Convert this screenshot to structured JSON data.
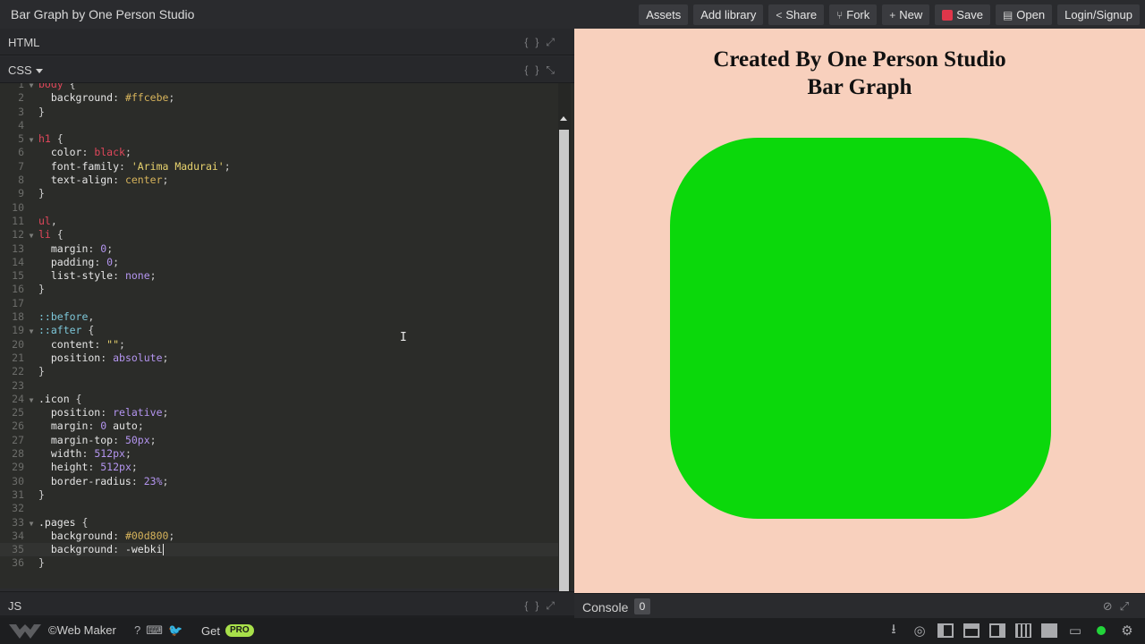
{
  "app": {
    "title": "Bar Graph by One Person Studio"
  },
  "toolbar": {
    "assets": "Assets",
    "add_library": "Add library",
    "share": "Share",
    "fork": "Fork",
    "new": "New",
    "save": "Save",
    "open": "Open",
    "login": "Login/Signup",
    "icons": {
      "share": "share-icon",
      "fork": "fork-icon",
      "new": "plus-icon",
      "save": "save-icon",
      "open": "document-icon"
    },
    "save_color": "#e0364a"
  },
  "panes": {
    "html_label": "HTML",
    "css_label": "CSS",
    "js_label": "JS",
    "tool_icons": [
      "braces-icon",
      "expand-icon"
    ]
  },
  "code": {
    "lines": [
      {
        "n": "1",
        "fold": true,
        "tokens": [
          {
            "t": "sel",
            "v": "body"
          },
          {
            "t": "pun",
            "v": " {"
          }
        ]
      },
      {
        "n": "2",
        "tokens": [
          {
            "t": "prop",
            "v": "  background"
          },
          {
            "t": "pun",
            "v": ": "
          },
          {
            "t": "val",
            "v": "#ffcebe"
          },
          {
            "t": "pun",
            "v": ";"
          }
        ]
      },
      {
        "n": "3",
        "tokens": [
          {
            "t": "pun",
            "v": "}"
          }
        ]
      },
      {
        "n": "4",
        "tokens": []
      },
      {
        "n": "5",
        "fold": true,
        "tokens": [
          {
            "t": "sel",
            "v": "h1"
          },
          {
            "t": "pun",
            "v": " {"
          }
        ]
      },
      {
        "n": "6",
        "tokens": [
          {
            "t": "prop",
            "v": "  color"
          },
          {
            "t": "pun",
            "v": ": "
          },
          {
            "t": "sel",
            "v": "black"
          },
          {
            "t": "pun",
            "v": ";"
          }
        ]
      },
      {
        "n": "7",
        "tokens": [
          {
            "t": "prop",
            "v": "  font-family"
          },
          {
            "t": "pun",
            "v": ": "
          },
          {
            "t": "str",
            "v": "'Arima Madurai'"
          },
          {
            "t": "pun",
            "v": ";"
          }
        ]
      },
      {
        "n": "8",
        "tokens": [
          {
            "t": "prop",
            "v": "  text-align"
          },
          {
            "t": "pun",
            "v": ": "
          },
          {
            "t": "val",
            "v": "center"
          },
          {
            "t": "pun",
            "v": ";"
          }
        ]
      },
      {
        "n": "9",
        "tokens": [
          {
            "t": "pun",
            "v": "}"
          }
        ]
      },
      {
        "n": "10",
        "tokens": []
      },
      {
        "n": "11",
        "tokens": [
          {
            "t": "sel",
            "v": "ul"
          },
          {
            "t": "pun",
            "v": ","
          }
        ]
      },
      {
        "n": "12",
        "fold": true,
        "tokens": [
          {
            "t": "sel",
            "v": "li"
          },
          {
            "t": "pun",
            "v": " {"
          }
        ]
      },
      {
        "n": "13",
        "tokens": [
          {
            "t": "prop",
            "v": "  margin"
          },
          {
            "t": "pun",
            "v": ": "
          },
          {
            "t": "num",
            "v": "0"
          },
          {
            "t": "pun",
            "v": ";"
          }
        ]
      },
      {
        "n": "14",
        "tokens": [
          {
            "t": "prop",
            "v": "  padding"
          },
          {
            "t": "pun",
            "v": ": "
          },
          {
            "t": "num",
            "v": "0"
          },
          {
            "t": "pun",
            "v": ";"
          }
        ]
      },
      {
        "n": "15",
        "tokens": [
          {
            "t": "prop",
            "v": "  list-style"
          },
          {
            "t": "pun",
            "v": ": "
          },
          {
            "t": "kw",
            "v": "none"
          },
          {
            "t": "pun",
            "v": ";"
          }
        ]
      },
      {
        "n": "16",
        "tokens": [
          {
            "t": "pun",
            "v": "}"
          }
        ]
      },
      {
        "n": "17",
        "tokens": []
      },
      {
        "n": "18",
        "tokens": [
          {
            "t": "pc",
            "v": "::before"
          },
          {
            "t": "pun",
            "v": ","
          }
        ]
      },
      {
        "n": "19",
        "fold": true,
        "tokens": [
          {
            "t": "pc",
            "v": "::after"
          },
          {
            "t": "pun",
            "v": " {"
          }
        ]
      },
      {
        "n": "20",
        "tokens": [
          {
            "t": "prop",
            "v": "  content"
          },
          {
            "t": "pun",
            "v": ": "
          },
          {
            "t": "str",
            "v": "\"\""
          },
          {
            "t": "pun",
            "v": ";"
          }
        ]
      },
      {
        "n": "21",
        "tokens": [
          {
            "t": "prop",
            "v": "  position"
          },
          {
            "t": "pun",
            "v": ": "
          },
          {
            "t": "kw",
            "v": "absolute"
          },
          {
            "t": "pun",
            "v": ";"
          }
        ]
      },
      {
        "n": "22",
        "tokens": [
          {
            "t": "pun",
            "v": "}"
          }
        ]
      },
      {
        "n": "23",
        "tokens": []
      },
      {
        "n": "24",
        "fold": true,
        "tokens": [
          {
            "t": "sel-b",
            "v": ".icon"
          },
          {
            "t": "pun",
            "v": " {"
          }
        ]
      },
      {
        "n": "25",
        "tokens": [
          {
            "t": "prop",
            "v": "  position"
          },
          {
            "t": "pun",
            "v": ": "
          },
          {
            "t": "kw",
            "v": "relative"
          },
          {
            "t": "pun",
            "v": ";"
          }
        ]
      },
      {
        "n": "26",
        "tokens": [
          {
            "t": "prop",
            "v": "  margin"
          },
          {
            "t": "pun",
            "v": ": "
          },
          {
            "t": "num",
            "v": "0"
          },
          {
            "t": "prop",
            "v": " auto"
          },
          {
            "t": "pun",
            "v": ";"
          }
        ]
      },
      {
        "n": "27",
        "tokens": [
          {
            "t": "prop",
            "v": "  margin-top"
          },
          {
            "t": "pun",
            "v": ": "
          },
          {
            "t": "num",
            "v": "50px"
          },
          {
            "t": "pun",
            "v": ";"
          }
        ]
      },
      {
        "n": "28",
        "tokens": [
          {
            "t": "prop",
            "v": "  width"
          },
          {
            "t": "pun",
            "v": ": "
          },
          {
            "t": "num",
            "v": "512px"
          },
          {
            "t": "pun",
            "v": ";"
          }
        ]
      },
      {
        "n": "29",
        "tokens": [
          {
            "t": "prop",
            "v": "  height"
          },
          {
            "t": "pun",
            "v": ": "
          },
          {
            "t": "num",
            "v": "512px"
          },
          {
            "t": "pun",
            "v": ";"
          }
        ]
      },
      {
        "n": "30",
        "tokens": [
          {
            "t": "prop",
            "v": "  border-radius"
          },
          {
            "t": "pun",
            "v": ": "
          },
          {
            "t": "num",
            "v": "23%"
          },
          {
            "t": "pun",
            "v": ";"
          }
        ]
      },
      {
        "n": "31",
        "tokens": [
          {
            "t": "pun",
            "v": "}"
          }
        ]
      },
      {
        "n": "32",
        "tokens": []
      },
      {
        "n": "33",
        "fold": true,
        "tokens": [
          {
            "t": "sel-b",
            "v": ".pages"
          },
          {
            "t": "pun",
            "v": " {"
          }
        ]
      },
      {
        "n": "34",
        "tokens": [
          {
            "t": "prop",
            "v": "  background"
          },
          {
            "t": "pun",
            "v": ": "
          },
          {
            "t": "val",
            "v": "#00d800"
          },
          {
            "t": "pun",
            "v": ";"
          }
        ]
      },
      {
        "n": "35",
        "active": true,
        "cursor": true,
        "tokens": [
          {
            "t": "prop",
            "v": "  background"
          },
          {
            "t": "pun",
            "v": ": "
          },
          {
            "t": "prop",
            "v": "-webki"
          }
        ]
      },
      {
        "n": "36",
        "tokens": [
          {
            "t": "pun",
            "v": "}"
          }
        ]
      }
    ]
  },
  "preview": {
    "heading_line1": "Created By One Person Studio",
    "heading_line2": "Bar Graph",
    "background": "#f8d0bd",
    "box_color": "#0bd80b"
  },
  "console": {
    "label": "Console",
    "count": "0"
  },
  "footer": {
    "brand": "©Web Maker",
    "get": "Get",
    "pro": "PRO",
    "pro_color": "#a8e04a",
    "left_icons": [
      "help-icon",
      "keyboard-icon",
      "twitter-icon"
    ],
    "right_icons": [
      "download-icon",
      "settings-circle-icon",
      "layout-1-icon",
      "layout-2-icon",
      "layout-3-icon",
      "layout-4-icon",
      "layout-full-icon",
      "screen-icon",
      "notification-icon",
      "gear-icon"
    ]
  }
}
